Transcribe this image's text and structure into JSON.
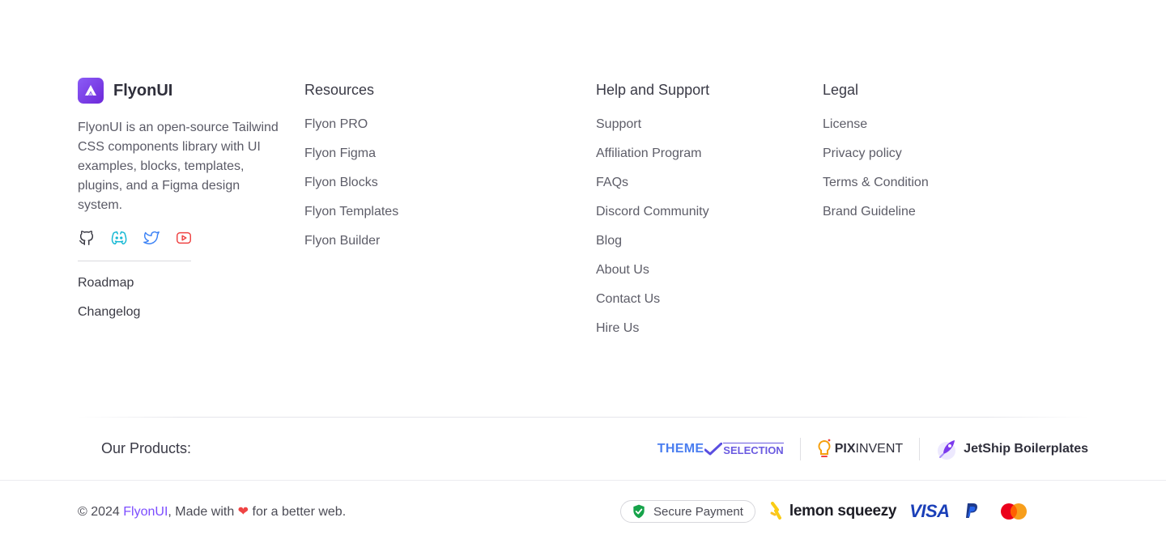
{
  "brand": {
    "name": "FlyonUI",
    "description": "FlyonUI is an open-source Tailwind CSS components library with UI examples, blocks, templates, plugins, and a Figma design system.",
    "socials": [
      "github-icon",
      "discord-icon",
      "twitter-icon",
      "youtube-icon"
    ],
    "links": [
      "Roadmap",
      "Changelog"
    ]
  },
  "resources": {
    "heading": "Resources",
    "items": [
      "Flyon PRO",
      "Flyon Figma",
      "Flyon Blocks",
      "Flyon Templates",
      "Flyon Builder"
    ]
  },
  "help": {
    "heading": "Help and Support",
    "items": [
      "Support",
      "Affiliation Program",
      "FAQs",
      "Discord Community",
      "Blog",
      "About Us",
      "Contact Us",
      "Hire Us"
    ]
  },
  "legal": {
    "heading": "Legal",
    "items": [
      "License",
      "Privacy policy",
      "Terms & Condition",
      "Brand Guideline"
    ]
  },
  "products": {
    "label": "Our Products:",
    "themeselection_a": "THEME",
    "themeselection_b": "SELECTION",
    "pixinvent_a": "PIX",
    "pixinvent_b": "INVENT",
    "jetship": "JetShip Boilerplates"
  },
  "footer": {
    "copy_prefix": "© 2024 ",
    "brand_link": "FlyonUI",
    "copy_mid": ", Made with ",
    "heart": "❤",
    "copy_suffix": " for a better web.",
    "secure_payment": "Secure Payment",
    "lemon": "lemon squeezy",
    "visa": "VISA"
  },
  "colors": {
    "accent": "#7c4dff",
    "heart": "#ef4444",
    "secure_shield": "#16a34a"
  }
}
